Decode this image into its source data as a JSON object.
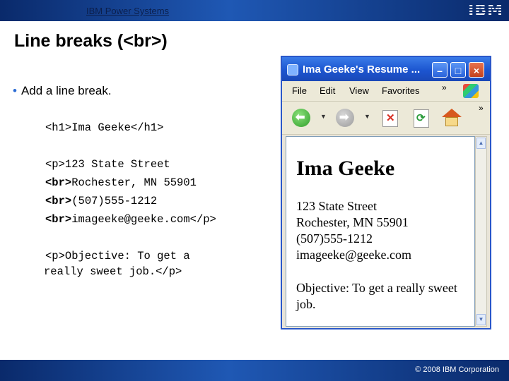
{
  "header": {
    "brand": "IBM Power Systems",
    "logo": "IBM"
  },
  "slide": {
    "title": "Line breaks (<br>)",
    "bullet": "Add a line break."
  },
  "code": {
    "h1_line": "<h1>Ima Geeke</h1>",
    "p1_line1": "<p>123 State Street",
    "p1_line2_tag": "<br>",
    "p1_line2_rest": "Rochester, MN 55901",
    "p1_line3_tag": "<br>",
    "p1_line3_rest": "(507)555-1212",
    "p1_line4_tag": "<br>",
    "p1_line4_rest": "imageeke@geeke.com</p>",
    "p2_line1": "<p>Objective: To get a",
    "p2_line2": "really sweet job.</p>"
  },
  "browser": {
    "title": "Ima Geeke's Resume ...",
    "menu": [
      "File",
      "Edit",
      "View",
      "Favorites"
    ],
    "overflow": "»",
    "content": {
      "heading": "Ima Geeke",
      "address_lines": [
        "123 State Street",
        "Rochester, MN 55901",
        "(507)555-1212",
        "imageeke@geeke.com"
      ],
      "objective_lines": [
        "Objective: To get a really sweet",
        "job."
      ]
    }
  },
  "footer": {
    "copyright": "© 2008 IBM Corporation"
  }
}
